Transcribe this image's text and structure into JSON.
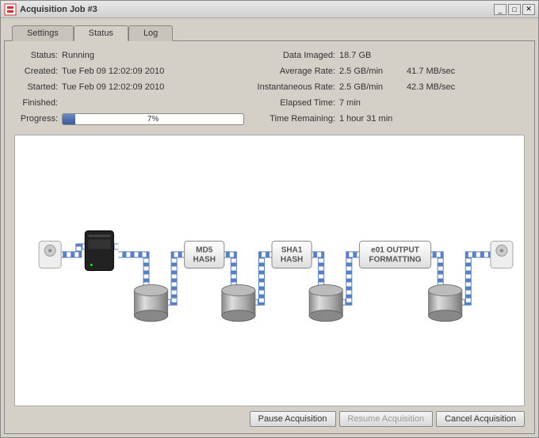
{
  "window": {
    "title": "Acquisition Job #3"
  },
  "tabs": {
    "settings": "Settings",
    "status": "Status",
    "log": "Log",
    "active_index": 1
  },
  "stats": {
    "status_label": "Status:",
    "status_value": "Running",
    "created_label": "Created:",
    "created_value": "Tue Feb 09 12:02:09 2010",
    "started_label": "Started:",
    "started_value": "Tue Feb 09 12:02:09 2010",
    "finished_label": "Finished:",
    "finished_value": "",
    "progress_label": "Progress:",
    "progress_pct": "7%",
    "data_imaged_label": "Data Imaged:",
    "data_imaged_value": "18.7 GB",
    "avg_rate_label": "Average Rate:",
    "avg_rate_value": "2.5 GB/min",
    "avg_rate_extra": "41.7 MB/sec",
    "inst_rate_label": "Instantaneous Rate:",
    "inst_rate_value": "2.5 GB/min",
    "inst_rate_extra": "42.3 MB/sec",
    "elapsed_label": "Elapsed Time:",
    "elapsed_value": "7 min",
    "remaining_label": "Time Remaining:",
    "remaining_value": "1 hour 31 min"
  },
  "stages": {
    "md5_l1": "MD5",
    "md5_l2": "HASH",
    "sha1_l1": "SHA1",
    "sha1_l2": "HASH",
    "fmt_l1": "e01 OUTPUT",
    "fmt_l2": "FORMATTING"
  },
  "buttons": {
    "pause": "Pause Acquisition",
    "resume": "Resume Acquisition",
    "cancel": "Cancel Acquisition"
  },
  "progress_value": 7
}
